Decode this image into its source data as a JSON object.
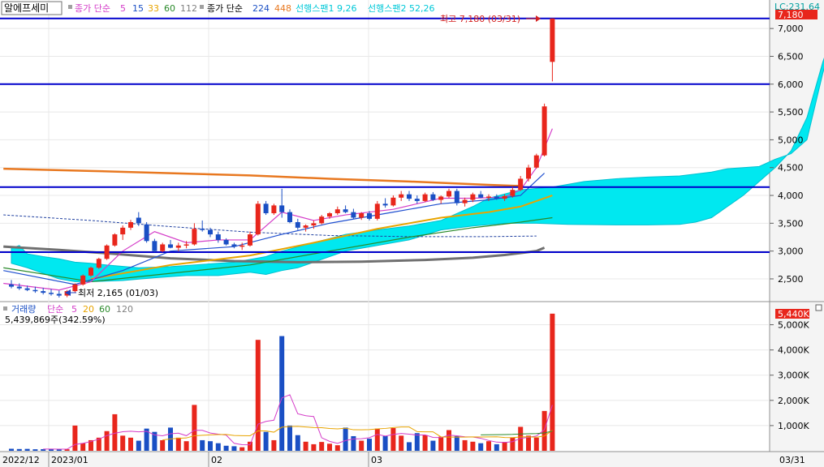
{
  "colors": {
    "up": "#e8261c",
    "down": "#1a4fc4",
    "hline": "#0000cc",
    "cloud": "#00e8f0",
    "ma5": "#d43cc8",
    "ma15": "#ff9a00",
    "ma33": "#e8a400",
    "ma60": "#2a8a2a",
    "ma112": "#2050d0",
    "ma224": "#e87820",
    "ma448": "#707070",
    "tag_bg": "#e8261c"
  },
  "header": {
    "title": "알에프세미",
    "ma_label": "종가 단순",
    "ma_periods": [
      "5",
      "15",
      "33",
      "60",
      "112"
    ],
    "ma_label2": "종가 단순",
    "ma_periods2": [
      "224",
      "448"
    ],
    "span1": "선행스팬1 9,26",
    "span2": "선행스팬2 52,26",
    "lc": "LC:231.64"
  },
  "price_axis": {
    "ticks": [
      "7,000",
      "6,500",
      "6,000",
      "5,500",
      "5,000",
      "4,500",
      "4,000",
      "3,500",
      "3,000",
      "2,500"
    ],
    "current_tag": "7,180"
  },
  "annotations": {
    "high": "최고 7,180 (03/31)",
    "low": "최저 2,165 (01/03)"
  },
  "volume_panel": {
    "legend_label": "거래량",
    "ma_label": "단순",
    "ma_periods": [
      "5",
      "20",
      "60",
      "120"
    ],
    "value_text": "5,439,869주(342.59%)",
    "current_tag": "5,440K",
    "ticks": [
      "5,000K",
      "4,000K",
      "3,000K",
      "2,000K",
      "1,000K"
    ]
  },
  "time_axis": {
    "labels": [
      "2022/12",
      "2023/01",
      "02",
      "03",
      "03/31"
    ]
  },
  "chart_data": {
    "type": "candlestick",
    "title": "알에프세미",
    "price_ylim": [
      2150,
      7250
    ],
    "volume_ylim": [
      0,
      5500
    ],
    "horizontal_lines": [
      7180,
      6000,
      4150,
      2980
    ],
    "ohlc": [
      [
        2400,
        2480,
        2330,
        2360
      ],
      [
        2360,
        2420,
        2300,
        2330
      ],
      [
        2330,
        2380,
        2280,
        2300
      ],
      [
        2300,
        2360,
        2250,
        2280
      ],
      [
        2280,
        2340,
        2220,
        2250
      ],
      [
        2250,
        2320,
        2200,
        2230
      ],
      [
        2230,
        2290,
        2165,
        2200
      ],
      [
        2200,
        2300,
        2170,
        2280
      ],
      [
        2280,
        2420,
        2250,
        2400
      ],
      [
        2400,
        2580,
        2380,
        2560
      ],
      [
        2560,
        2720,
        2540,
        2700
      ],
      [
        2700,
        2880,
        2680,
        2860
      ],
      [
        2860,
        3120,
        2840,
        3100
      ],
      [
        3100,
        3320,
        3080,
        3300
      ],
      [
        3300,
        3460,
        3200,
        3420
      ],
      [
        3420,
        3560,
        3380,
        3520
      ],
      [
        3600,
        3700,
        3450,
        3500
      ],
      [
        3480,
        3520,
        3150,
        3180
      ],
      [
        3180,
        3220,
        2980,
        3000
      ],
      [
        3000,
        3150,
        2980,
        3120
      ],
      [
        3120,
        3200,
        3050,
        3060
      ],
      [
        3060,
        3150,
        3000,
        3100
      ],
      [
        3100,
        3180,
        3050,
        3120
      ],
      [
        3120,
        3500,
        3100,
        3400
      ],
      [
        3400,
        3550,
        3350,
        3380
      ],
      [
        3380,
        3420,
        3250,
        3300
      ],
      [
        3300,
        3350,
        3150,
        3200
      ],
      [
        3200,
        3230,
        3100,
        3120
      ],
      [
        3120,
        3150,
        3050,
        3080
      ],
      [
        3080,
        3150,
        3020,
        3100
      ],
      [
        3100,
        3350,
        3080,
        3300
      ],
      [
        3300,
        3900,
        3280,
        3850
      ],
      [
        3850,
        3900,
        3650,
        3680
      ],
      [
        3680,
        3850,
        3650,
        3820
      ],
      [
        3820,
        4120,
        3600,
        3700
      ],
      [
        3700,
        3750,
        3500,
        3520
      ],
      [
        3520,
        3580,
        3380,
        3420
      ],
      [
        3420,
        3480,
        3350,
        3460
      ],
      [
        3460,
        3550,
        3400,
        3500
      ],
      [
        3500,
        3650,
        3480,
        3620
      ],
      [
        3620,
        3700,
        3580,
        3680
      ],
      [
        3680,
        3800,
        3650,
        3750
      ],
      [
        3750,
        3820,
        3680,
        3700
      ],
      [
        3700,
        3760,
        3580,
        3600
      ],
      [
        3600,
        3700,
        3560,
        3680
      ],
      [
        3680,
        3720,
        3550,
        3580
      ],
      [
        3580,
        3900,
        3550,
        3850
      ],
      [
        3850,
        3950,
        3780,
        3820
      ],
      [
        3820,
        4000,
        3800,
        3960
      ],
      [
        3960,
        4080,
        3900,
        4020
      ],
      [
        4020,
        4080,
        3900,
        3940
      ],
      [
        3940,
        4000,
        3850,
        3900
      ],
      [
        3900,
        4050,
        3880,
        4020
      ],
      [
        4020,
        4060,
        3900,
        3920
      ],
      [
        3920,
        4000,
        3850,
        3980
      ],
      [
        3980,
        4120,
        3950,
        4080
      ],
      [
        4080,
        4120,
        3820,
        3860
      ],
      [
        3860,
        3960,
        3800,
        3920
      ],
      [
        3920,
        4050,
        3880,
        4020
      ],
      [
        4020,
        4080,
        3950,
        3960
      ],
      [
        3960,
        4020,
        3900,
        3980
      ],
      [
        3980,
        4020,
        3920,
        3940
      ],
      [
        3940,
        4020,
        3900,
        3990
      ],
      [
        3990,
        4150,
        3960,
        4100
      ],
      [
        4100,
        4350,
        4080,
        4300
      ],
      [
        4300,
        4550,
        4250,
        4500
      ],
      [
        4500,
        4750,
        4480,
        4720
      ],
      [
        4720,
        5650,
        4700,
        5600
      ],
      [
        6400,
        7180,
        6050,
        7180
      ]
    ],
    "volume": [
      80,
      70,
      75,
      60,
      65,
      70,
      60,
      60,
      1000,
      300,
      420,
      520,
      780,
      1450,
      600,
      520,
      400,
      880,
      750,
      420,
      920,
      520,
      380,
      1820,
      420,
      380,
      300,
      200,
      180,
      140,
      360,
      4400,
      750,
      420,
      4550,
      1000,
      620,
      360,
      260,
      350,
      280,
      220,
      920,
      580,
      400,
      480,
      880,
      580,
      900,
      600,
      340,
      700,
      620,
      400,
      560,
      820,
      580,
      420,
      360,
      300,
      380,
      260,
      350,
      520,
      950,
      600,
      520,
      1580,
      5440
    ]
  }
}
